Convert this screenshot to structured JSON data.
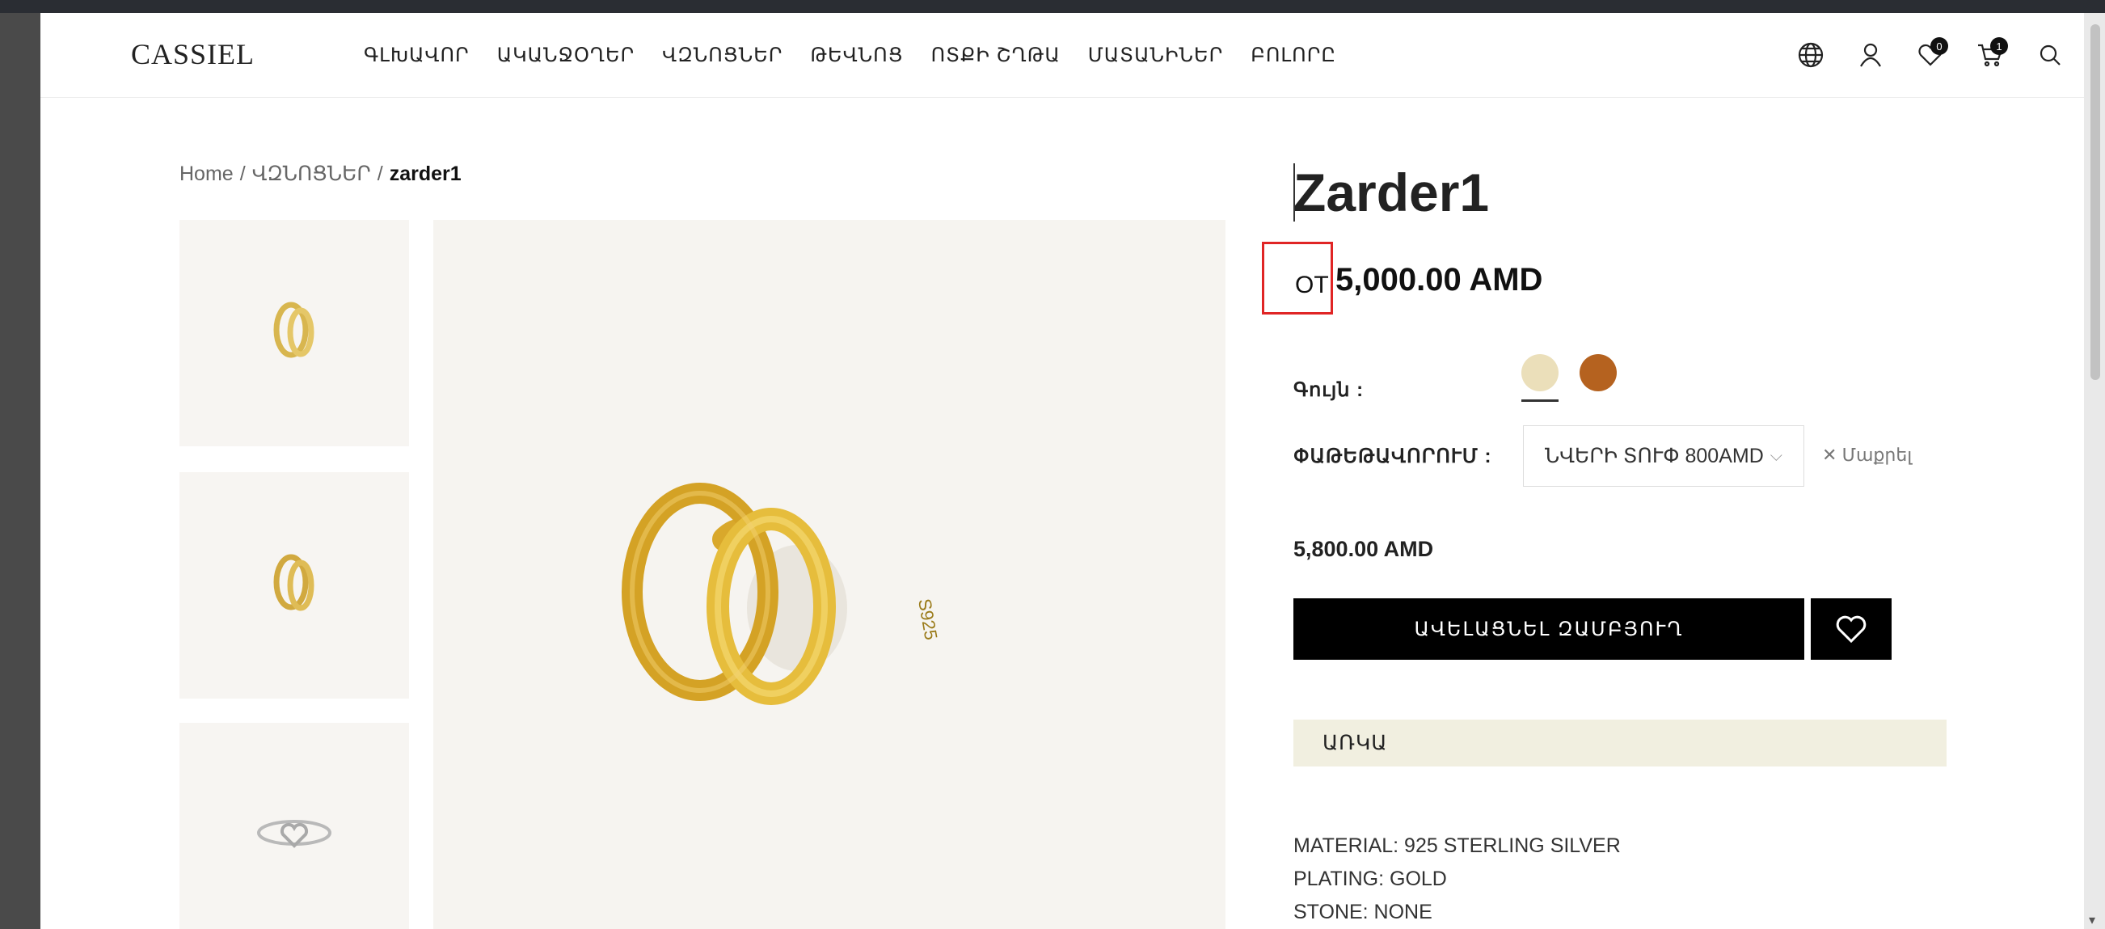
{
  "header": {
    "logo": "CASSIEL",
    "nav": [
      "ԳԼԽԱՎՈՐ",
      "ԱԿԱՆՋՕՂԵՐ",
      "ՎԶՆՈՑՆԵՐ",
      "ԹԵՎՆՈՑ",
      "ՈՏՔԻ ՇՂԹԱ",
      "ՄԱՏԱՆԻՆԵՐ",
      "ԲՈԼՈՐԸ"
    ],
    "wishlist_count": "0",
    "cart_count": "1"
  },
  "breadcrumb": {
    "home": "Home",
    "category": "ՎԶՆՈՑՆԵՐ",
    "current": "zarder1"
  },
  "product": {
    "title": "Zarder1",
    "from_label": "ОТ",
    "price": "5,000.00 AMD",
    "color_label": "Գույն :",
    "colors": [
      "#ebdfba",
      "#b5621f"
    ],
    "packaging_label": "ՓԱԹԵԹԱՎՈՐՈՒՄ :",
    "packaging_value": "ՆՎԵՐԻ ՏՈՒՓ 800AMD",
    "clear_label": "Մաքրել",
    "variation_price": "5,800.00 AMD",
    "add_to_cart": "ԱՎԵԼԱՑՆԵԼ ԶԱՄԲՅՈՒՂ",
    "tab": "ԱՌԿԱ",
    "description": [
      "MATERIAL: 925 STERLING SILVER",
      "PLATING: GOLD",
      "STONE: NONE"
    ]
  },
  "colors": {
    "accent": "#000000",
    "tab_bg": "#f1efe0",
    "highlight_box": "#e02525"
  }
}
